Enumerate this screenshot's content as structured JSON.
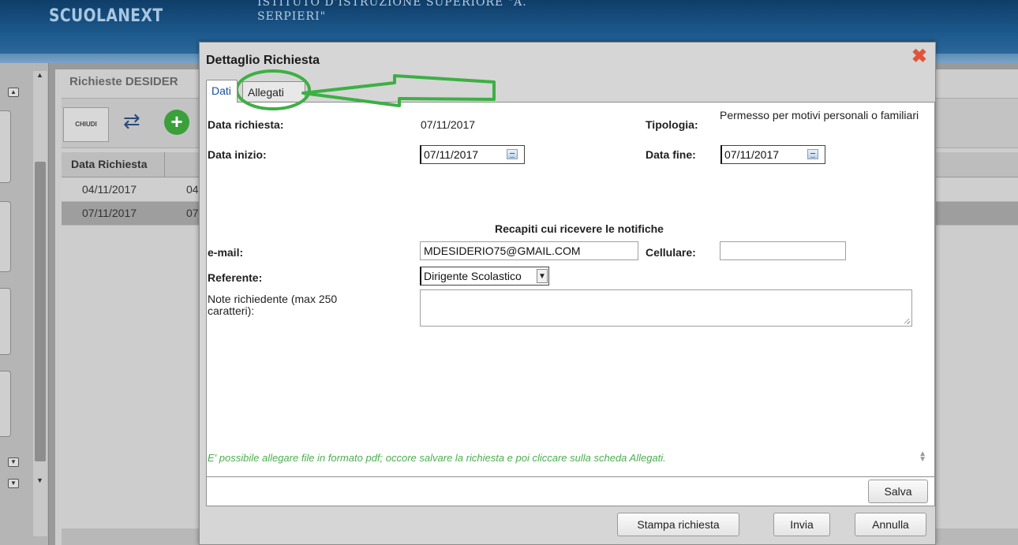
{
  "app": {
    "logo": "SCUOLANEXT",
    "school_line1": "ISTITUTO D'ISTRUZIONE SUPERIORE \"A.",
    "school_line2": "SERPIERI\""
  },
  "background": {
    "panel_title": "Richieste DESIDER",
    "chiudi_label": "CHIUDI",
    "table_header": "Data Richiesta",
    "rows": [
      {
        "date": "04/11/2017",
        "next": "04"
      },
      {
        "date": "07/11/2017",
        "next": "07"
      }
    ]
  },
  "dialog": {
    "title": "Dettaglio Richiesta",
    "close_icon": "close-x-icon",
    "tabs": [
      {
        "label": "Dati",
        "active": true
      },
      {
        "label": "Allegati",
        "active": false
      }
    ],
    "fields": {
      "data_richiesta_label": "Data richiesta:",
      "data_richiesta_value": "07/11/2017",
      "tipologia_label": "Tipologia:",
      "tipologia_value": "Permesso per motivi personali o familiari",
      "data_inizio_label": "Data inizio:",
      "data_inizio_value": "07/11/2017",
      "data_fine_label": "Data fine:",
      "data_fine_value": "07/11/2017",
      "notifiche_heading": "Recapiti cui ricevere le notifiche",
      "email_label": "e-mail:",
      "email_value": "MDESIDERIO75@GMAIL.COM",
      "cellulare_label": "Cellulare:",
      "cellulare_value": "",
      "referente_label": "Referente:",
      "referente_value": "Dirigente Scolastico",
      "note_label": "Note richiedente (max 250 caratteri):",
      "note_value": ""
    },
    "hint": "E' possibile allegare file in formato pdf; occore salvare la richiesta e poi cliccare sulla scheda Allegati.",
    "buttons": {
      "salva": "Salva",
      "stampa": "Stampa richiesta",
      "invia": "Invia",
      "annulla": "Annulla"
    }
  },
  "annotation": {
    "color": "#3cb043",
    "shape": "circle-and-arrow pointing to Allegati tab"
  }
}
